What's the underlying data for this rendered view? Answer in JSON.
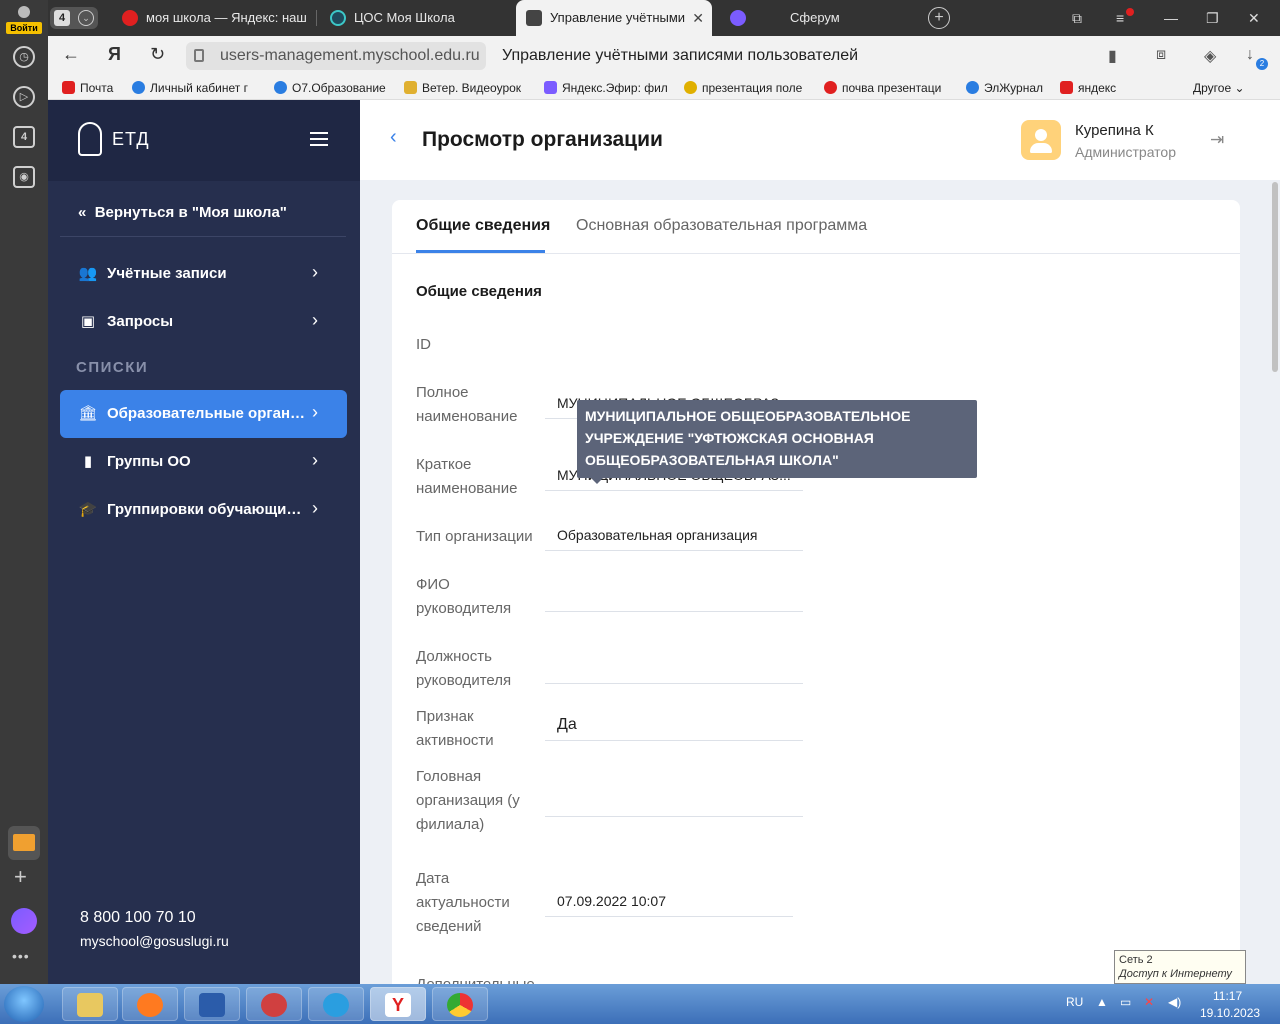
{
  "side_panel": {
    "login_label": "Войти",
    "counter_label": "4"
  },
  "tabs": {
    "count": "4",
    "items": [
      {
        "title": "моя школа — Яндекс: наш",
        "favicon_color": "#e02020"
      },
      {
        "title": "ЦОС Моя Школа",
        "favicon_color": "#3cc8c8"
      },
      {
        "title": "Управление учётными",
        "favicon_color": "#444444",
        "active": true
      },
      {
        "title": "Сферум",
        "favicon_color": "#7b5cff"
      }
    ]
  },
  "address": {
    "url": "users-management.myschool.edu.ru",
    "page_title": "Управление учётными записями пользователей",
    "downloads_badge": "2"
  },
  "bookmarks": [
    {
      "label": "Почта",
      "color": "#e02020"
    },
    {
      "label": "Личный кабинет г",
      "color": "#2a7de1"
    },
    {
      "label": "О7.Образование",
      "color": "#2a7de1"
    },
    {
      "label": "Ветер. Видеоурок",
      "color": "#e0b030"
    },
    {
      "label": "Яндекс.Эфир: фил",
      "color": "#7b5cff"
    },
    {
      "label": "презентация поле",
      "color": "#e0b000"
    },
    {
      "label": "почва презентаци",
      "color": "#e02020"
    },
    {
      "label": "ЭлЖурнал",
      "color": "#2a7de1"
    },
    {
      "label": "яндекс",
      "color": "#e02020"
    }
  ],
  "bookmarks_other": "Другое",
  "sidebar": {
    "logo": "ЕТД",
    "back_link": "Вернуться в \"Моя школа\"",
    "items": [
      {
        "label": "Учётные записи",
        "icon": "users-icon"
      },
      {
        "label": "Запросы",
        "icon": "inbox-icon"
      }
    ],
    "section_label": "СПИСКИ",
    "list_items": [
      {
        "label": "Образовательные организа...",
        "icon": "institution-icon",
        "active": true
      },
      {
        "label": "Группы ОО",
        "icon": "bookmark-icon"
      },
      {
        "label": "Группировки обучающихся",
        "icon": "graduation-cap-icon"
      }
    ],
    "phone": "8 800 100 70 10",
    "email": "myschool@gosuslugi.ru"
  },
  "header": {
    "title": "Просмотр организации",
    "user_name": "Курепина К",
    "user_role": "Администратор"
  },
  "content_tabs": [
    {
      "label": "Общие сведения",
      "active": true
    },
    {
      "label": "Основная образовательная программа",
      "active": false
    }
  ],
  "section_title": "Общие сведения",
  "tooltip": "МУНИЦИПАЛЬНОЕ ОБЩЕОБРАЗОВАТЕЛЬНОЕ УЧРЕЖДЕНИЕ \"УФТЮЖСКАЯ ОСНОВНАЯ ОБЩЕОБРАЗОВАТЕЛЬНАЯ ШКОЛА\"",
  "fields": [
    {
      "label": "ID",
      "value": ""
    },
    {
      "label": "Полное наименование",
      "value": "МУНИЦИПАЛЬНОЕ ОБЩЕОБРАЗ..."
    },
    {
      "label": "Краткое наименование",
      "value": "МУНИЦИПАЛЬНОЕ ОБЩЕОБРАЗ..."
    },
    {
      "label": "Тип организации",
      "value": "Образовательная организация"
    },
    {
      "label": "ФИО руководителя",
      "value": ""
    },
    {
      "label": "Должность руководителя",
      "value": ""
    },
    {
      "label": "Признак активности",
      "value": "Да"
    },
    {
      "label": "Головная организация (у филиала)",
      "value": ""
    },
    {
      "label": "Дата актуальности сведений",
      "value": "07.09.2022 10:07"
    },
    {
      "label": "Дополнительные",
      "value": ""
    }
  ],
  "network_tooltip": {
    "line1": "Сеть  2",
    "line2": "Доступ к Интернету"
  },
  "taskbar": {
    "lang": "RU",
    "time": "11:17",
    "date": "19.10.2023"
  }
}
